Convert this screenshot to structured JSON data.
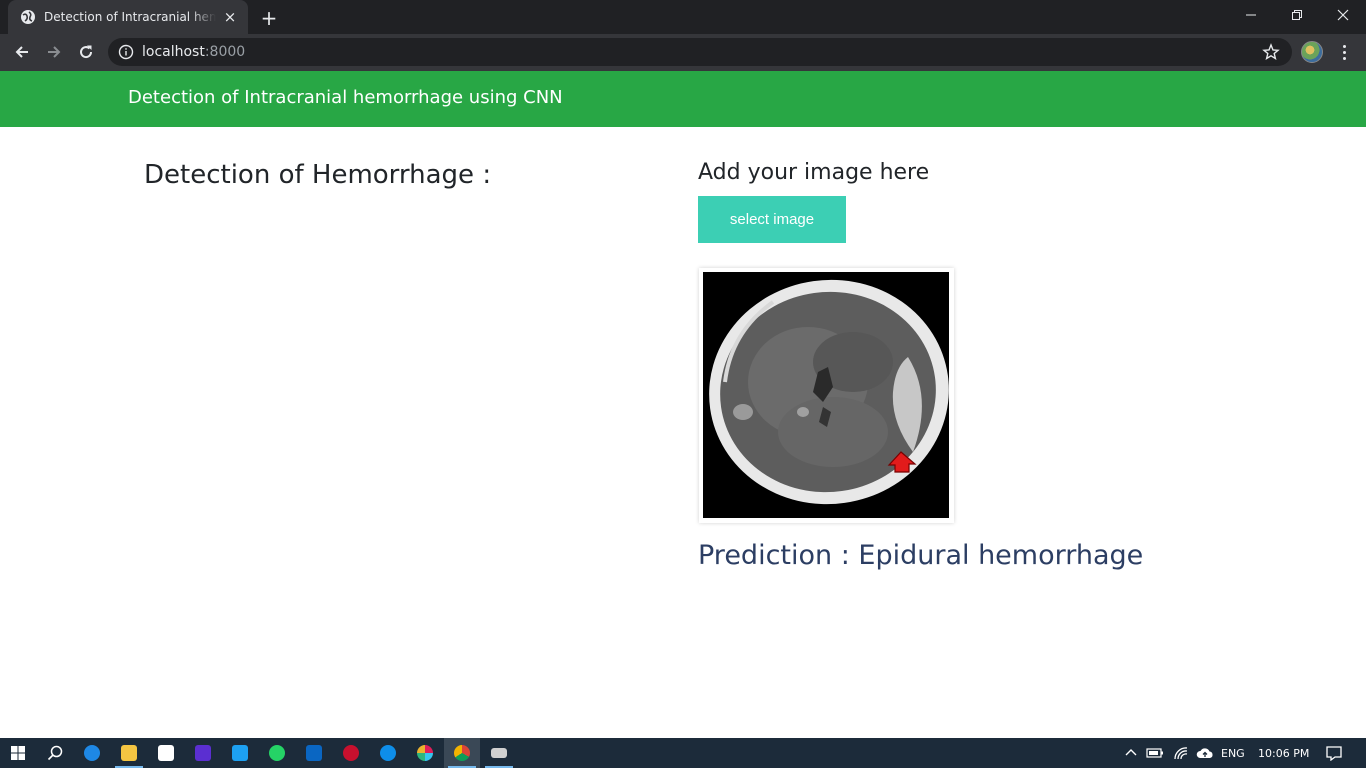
{
  "browser": {
    "tab_title": "Detection of Intracranial hemorrhage using CNN",
    "new_tab": "+",
    "close_tab": "×",
    "url_host": "localhost",
    "url_port": ":8000"
  },
  "header": {
    "brand": "Detection of Intracranial hemorrhage using CNN"
  },
  "main": {
    "left_heading": "Detection of Hemorrhage :",
    "right_heading": "Add your image here",
    "select_button": "select image",
    "prediction": "Prediction : Epidural hemorrhage"
  },
  "taskbar": {
    "language": "ENG",
    "time": "10:06 PM"
  },
  "colors": {
    "header_green": "#28a745",
    "button_teal": "#3ccfb4",
    "prediction_text": "#2c3e63"
  }
}
